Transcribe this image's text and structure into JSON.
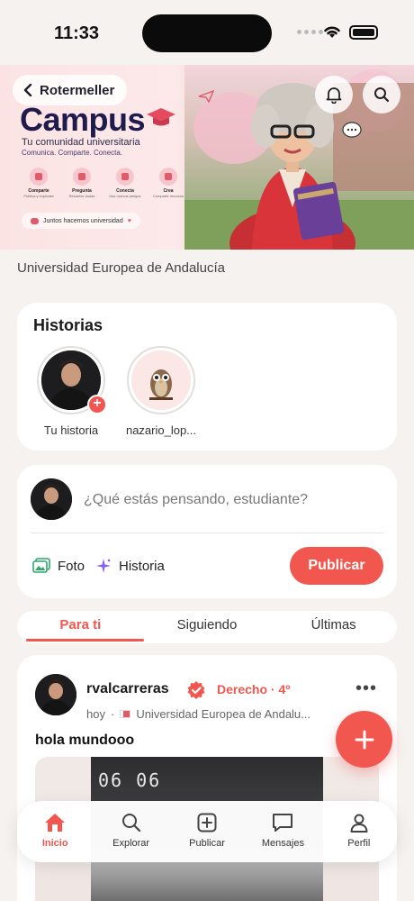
{
  "status_bar": {
    "time": "11:33"
  },
  "banner": {
    "back_label": "Rotermeller",
    "title": "Campus",
    "tagline": "Tu comunidad universitaria",
    "tagline2": "Comunica. Comparte. Conecta.",
    "features": [
      {
        "title": "Comparte",
        "sub": "Publica y explícate"
      },
      {
        "title": "Pregunta",
        "sub": "Resuelve dudas"
      },
      {
        "title": "Conecta",
        "sub": "Haz nuevos amigos"
      },
      {
        "title": "Crea",
        "sub": "Comparte recursos"
      }
    ],
    "together_label": "Juntos hacemos universidad"
  },
  "university": "Universidad Europea de Andalucía",
  "stories": {
    "title": "Historias",
    "items": [
      {
        "name": "Tu historia"
      },
      {
        "name": "nazario_lop..."
      }
    ]
  },
  "composer": {
    "placeholder": "¿Qué estás pensando, estudiante?",
    "photo_label": "Foto",
    "story_label": "Historia",
    "publish_label": "Publicar"
  },
  "feed_tabs": [
    "Para ti",
    "Siguiendo",
    "Últimas"
  ],
  "post": {
    "username": "rvalcarreras",
    "meta": "Derecho · 4º",
    "time": "hoy",
    "university": "Universidad Europea de Andalu...",
    "text": "hola mundooo",
    "media_display": "06 06"
  },
  "bottom_nav": [
    {
      "label": "Inicio",
      "icon": "home-icon"
    },
    {
      "label": "Explorar",
      "icon": "search-icon"
    },
    {
      "label": "Publicar",
      "icon": "plus-square-icon"
    },
    {
      "label": "Mensajes",
      "icon": "message-icon"
    },
    {
      "label": "Perfil",
      "icon": "user-icon"
    }
  ],
  "colors": {
    "accent": "#f1574f",
    "background": "#f5f2ef",
    "brand_navy": "#1f1c4d"
  }
}
